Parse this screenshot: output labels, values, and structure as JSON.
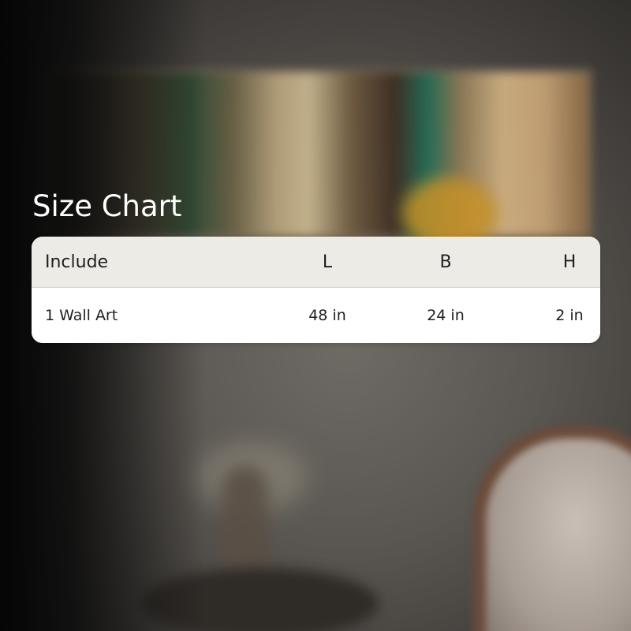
{
  "size_chart": {
    "title": "Size Chart",
    "columns": [
      "Include",
      "L",
      "B",
      "H"
    ],
    "rows": [
      [
        "1 Wall Art",
        "48 in",
        "24 in",
        "2 in"
      ]
    ]
  },
  "colors": {
    "header_bg": "#ecebe6",
    "card_bg": "#ffffff",
    "title_text": "#ffffff",
    "table_text": "#1f1f1f"
  }
}
